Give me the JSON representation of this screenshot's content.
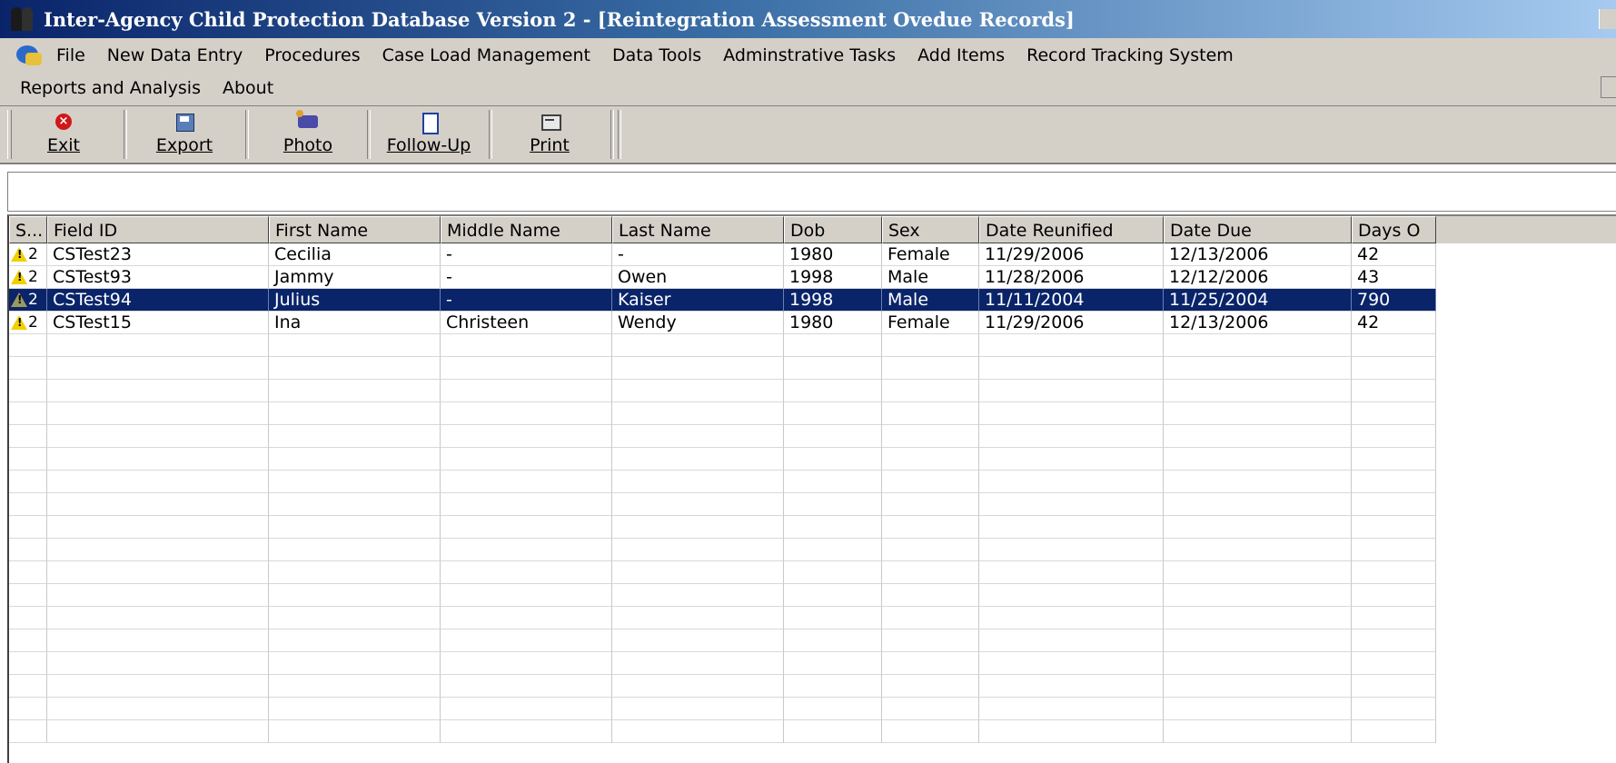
{
  "window": {
    "title": "Inter-Agency Child Protection Database Version 2 - [Reintegration Assessment Ovedue Records]",
    "title_icon": "two-people-icon",
    "app_icon": "globe-app-icon"
  },
  "menu": {
    "items_row1": [
      "File",
      "New Data Entry",
      "Procedures",
      "Case Load Management",
      "Data Tools",
      "Adminstrative Tasks",
      "Add Items",
      "Record Tracking System"
    ],
    "items_row2": [
      "Reports and Analysis",
      "About"
    ]
  },
  "toolbar": {
    "exit": {
      "label": "Exit",
      "icon": "exit-icon"
    },
    "export": {
      "label": "Export",
      "icon": "floppy-disk-icon"
    },
    "photo": {
      "label": "Photo",
      "icon": "camera-icon"
    },
    "followup": {
      "label": "Follow-Up",
      "icon": "clipboard-icon"
    },
    "print": {
      "label": "Print",
      "icon": "printer-icon"
    }
  },
  "filter": {
    "value": ""
  },
  "grid": {
    "columns": [
      "S...",
      "Field ID",
      "First Name",
      "Middle Name",
      "Last Name",
      "Dob",
      "Sex",
      "Date Reunified",
      "Date Due",
      "Days O"
    ],
    "rows": [
      {
        "status_icon": "warning-icon",
        "status": "2",
        "field_id": "CSTest23",
        "first": "Cecilia",
        "middle": "-",
        "last": "-",
        "dob": "1980",
        "sex": "Female",
        "reunified": "11/29/2006",
        "due": "12/13/2006",
        "days": "42"
      },
      {
        "status_icon": "warning-icon",
        "status": "2",
        "field_id": "CSTest93",
        "first": "Jammy",
        "middle": "-",
        "last": "Owen",
        "dob": "1998",
        "sex": "Male",
        "reunified": "11/28/2006",
        "due": "12/12/2006",
        "days": "43"
      },
      {
        "status_icon": "warning-icon",
        "status": "2",
        "field_id": "CSTest94",
        "first": "Julius",
        "middle": "-",
        "last": "Kaiser",
        "dob": "1998",
        "sex": "Male",
        "reunified": "11/11/2004",
        "due": "11/25/2004",
        "days": "790"
      },
      {
        "status_icon": "warning-icon",
        "status": "2",
        "field_id": "CSTest15",
        "first": "Ina",
        "middle": "Christeen",
        "last": "Wendy",
        "dob": "1980",
        "sex": "Female",
        "reunified": "11/29/2006",
        "due": "12/13/2006",
        "days": "42"
      }
    ],
    "selected_row": 2,
    "colors": {
      "selection": "#0a246a",
      "warning": "#f0d000"
    }
  }
}
